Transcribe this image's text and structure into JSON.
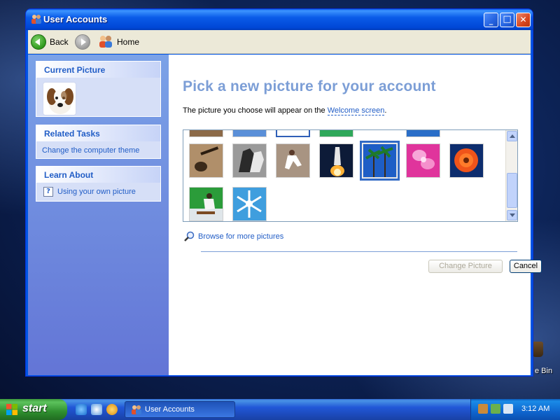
{
  "window": {
    "title": "User Accounts"
  },
  "toolbar": {
    "back_label": "Back",
    "home_label": "Home"
  },
  "sidebar": {
    "current_picture_title": "Current Picture",
    "related_tasks_title": "Related Tasks",
    "related_tasks": [
      {
        "label": "Change the computer theme"
      }
    ],
    "learn_about_title": "Learn About",
    "learn_about": [
      {
        "label": "Using your own picture"
      }
    ]
  },
  "main": {
    "heading": "Pick a new picture for your account",
    "subtext_prefix": "The picture you choose will appear on the ",
    "subtext_link": "Welcome screen",
    "subtext_suffix": ".",
    "browse_label": "Browse for more pictures",
    "change_button": "Change Picture",
    "cancel_button": "Cancel"
  },
  "pictures": [
    {
      "name": "guitar",
      "color": "#a98660"
    },
    {
      "name": "horses",
      "color": "#6a6a6a"
    },
    {
      "name": "karate",
      "color": "#8e7c6c"
    },
    {
      "name": "space-shuttle",
      "color": "#2f4a7a"
    },
    {
      "name": "palm-trees",
      "color": "#2160b8",
      "selected": true
    },
    {
      "name": "pink-flower",
      "color": "#e04aa7"
    },
    {
      "name": "orange-flower",
      "color": "#d8401c"
    },
    {
      "name": "skateboarder",
      "color": "#2b9c3a"
    },
    {
      "name": "snowflake",
      "color": "#3f9ede"
    }
  ],
  "desktop": {
    "recycle_bin_label": "e Bin"
  },
  "taskbar": {
    "start_label": "start",
    "task_label": "User Accounts",
    "clock": "3:12 AM"
  }
}
